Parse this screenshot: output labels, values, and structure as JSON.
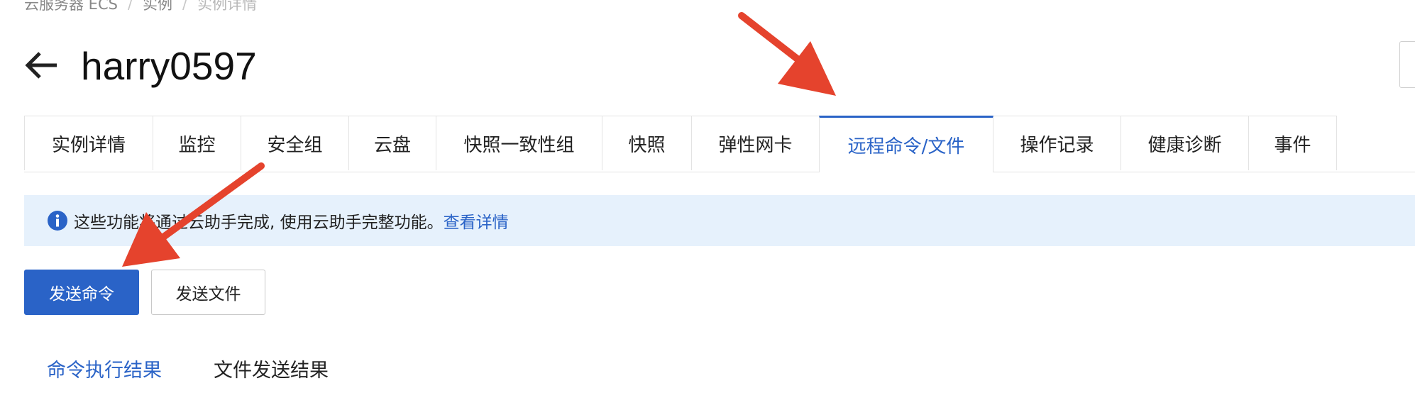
{
  "breadcrumb": {
    "items": [
      "云服务器 ECS",
      "实例",
      "实例详情"
    ],
    "separator": "/"
  },
  "header": {
    "title": "harry0597",
    "back_icon": "arrow-left-icon"
  },
  "tabs": [
    {
      "label": "实例详情",
      "active": false
    },
    {
      "label": "监控",
      "active": false
    },
    {
      "label": "安全组",
      "active": false
    },
    {
      "label": "云盘",
      "active": false
    },
    {
      "label": "快照一致性组",
      "active": false
    },
    {
      "label": "快照",
      "active": false
    },
    {
      "label": "弹性网卡",
      "active": false
    },
    {
      "label": "远程命令/文件",
      "active": true
    },
    {
      "label": "操作记录",
      "active": false
    },
    {
      "label": "健康诊断",
      "active": false
    },
    {
      "label": "事件",
      "active": false
    }
  ],
  "alert": {
    "icon": "info-icon",
    "text": "这些功能将通过云助手完成, 使用云助手完整功能。",
    "link": "查看详情"
  },
  "actions": {
    "send_command": "发送命令",
    "send_file": "发送文件"
  },
  "result_tabs": [
    {
      "label": "命令执行结果",
      "active": true
    },
    {
      "label": "文件发送结果",
      "active": false
    }
  ],
  "colors": {
    "accent": "#2a63c7",
    "alert_bg": "#e6f1fc",
    "annotation_arrow": "#e5432d"
  }
}
